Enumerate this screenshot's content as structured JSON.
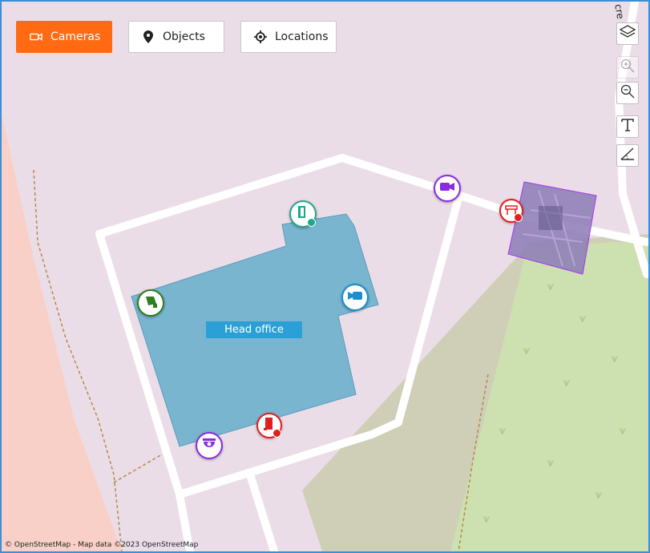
{
  "toolbar": {
    "tabs": [
      {
        "label": "Cameras",
        "icon": "camera-icon",
        "active": true
      },
      {
        "label": "Objects",
        "icon": "map-pin-icon",
        "active": false
      },
      {
        "label": "Locations",
        "icon": "crosshair-icon",
        "active": false
      }
    ]
  },
  "map_tools": [
    {
      "name": "layers-button",
      "icon": "layers-icon"
    },
    {
      "name": "zoom-in-button",
      "icon": "zoom-in-icon",
      "disabled": true
    },
    {
      "name": "zoom-out-button",
      "icon": "zoom-out-icon"
    },
    {
      "name": "text-tool-button",
      "icon": "text-icon"
    },
    {
      "name": "angle-tool-button",
      "icon": "angle-icon"
    }
  ],
  "map": {
    "building_label": "Head office",
    "street_label": "cre s",
    "attribution": "© OpenStreetMap - Map data ©2023 OpenStreetMap"
  },
  "markers": [
    {
      "name": "door-sensor-marker",
      "icon": "door-icon",
      "color": "#1ea88a"
    },
    {
      "name": "camera-marker-purple",
      "icon": "video-camera-icon",
      "color": "#8a2be2"
    },
    {
      "name": "barrier-marker",
      "icon": "barrier-icon",
      "color": "#e02020"
    },
    {
      "name": "camera-marker-green",
      "icon": "ptz-camera-icon",
      "color": "#2e7d1e"
    },
    {
      "name": "camera-marker-blue",
      "icon": "video-camera-icon",
      "color": "#1a8fd0"
    },
    {
      "name": "door-alarm-marker",
      "icon": "door-icon",
      "color": "#e02020"
    },
    {
      "name": "dome-camera-marker",
      "icon": "dome-camera-icon",
      "color": "#8a2be2"
    }
  ],
  "colors": {
    "accent": "#ff6a13",
    "building": "#7ab5cf",
    "label_bg": "#2aa0d6",
    "frame": "#3a8fd6"
  }
}
